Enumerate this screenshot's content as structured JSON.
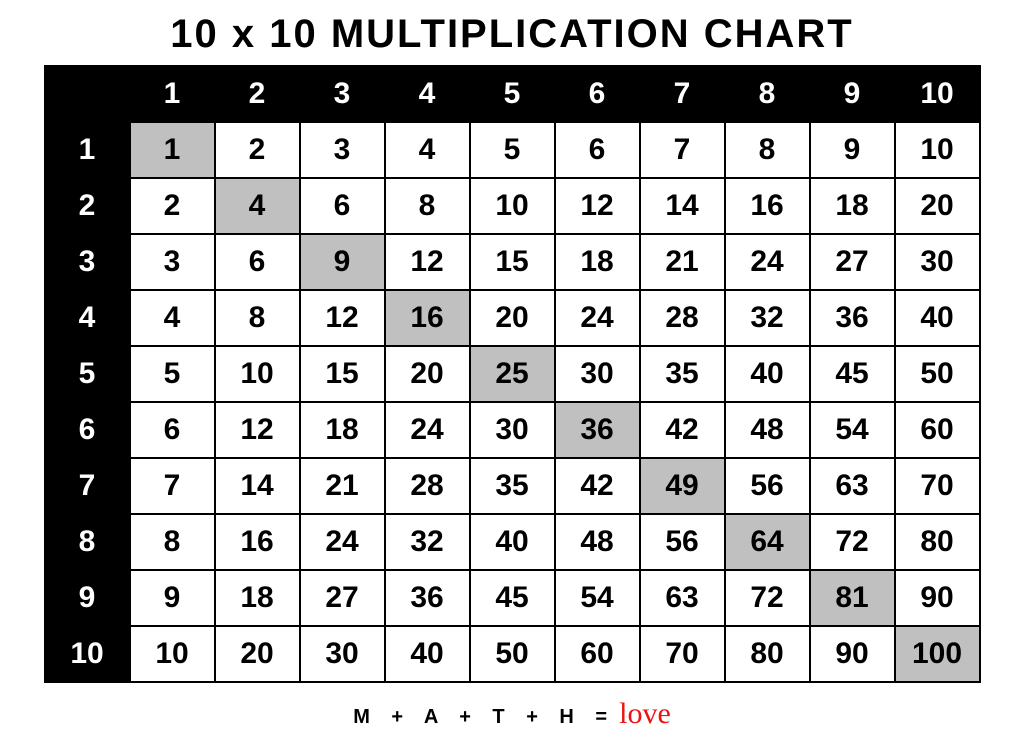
{
  "title": "10 x 10 MULTIPLICATION CHART",
  "size": 10,
  "col_headers": [
    "1",
    "2",
    "3",
    "4",
    "5",
    "6",
    "7",
    "8",
    "9",
    "10"
  ],
  "row_headers": [
    "1",
    "2",
    "3",
    "4",
    "5",
    "6",
    "7",
    "8",
    "9",
    "10"
  ],
  "grid": [
    [
      "1",
      "2",
      "3",
      "4",
      "5",
      "6",
      "7",
      "8",
      "9",
      "10"
    ],
    [
      "2",
      "4",
      "6",
      "8",
      "10",
      "12",
      "14",
      "16",
      "18",
      "20"
    ],
    [
      "3",
      "6",
      "9",
      "12",
      "15",
      "18",
      "21",
      "24",
      "27",
      "30"
    ],
    [
      "4",
      "8",
      "12",
      "16",
      "20",
      "24",
      "28",
      "32",
      "36",
      "40"
    ],
    [
      "5",
      "10",
      "15",
      "20",
      "25",
      "30",
      "35",
      "40",
      "45",
      "50"
    ],
    [
      "6",
      "12",
      "18",
      "24",
      "30",
      "36",
      "42",
      "48",
      "54",
      "60"
    ],
    [
      "7",
      "14",
      "21",
      "28",
      "35",
      "42",
      "49",
      "56",
      "63",
      "70"
    ],
    [
      "8",
      "16",
      "24",
      "32",
      "40",
      "48",
      "56",
      "64",
      "72",
      "80"
    ],
    [
      "9",
      "18",
      "27",
      "36",
      "45",
      "54",
      "63",
      "72",
      "81",
      "90"
    ],
    [
      "10",
      "20",
      "30",
      "40",
      "50",
      "60",
      "70",
      "80",
      "90",
      "100"
    ]
  ],
  "footer": {
    "prefix": "M + A + T + H =",
    "love": "love"
  }
}
